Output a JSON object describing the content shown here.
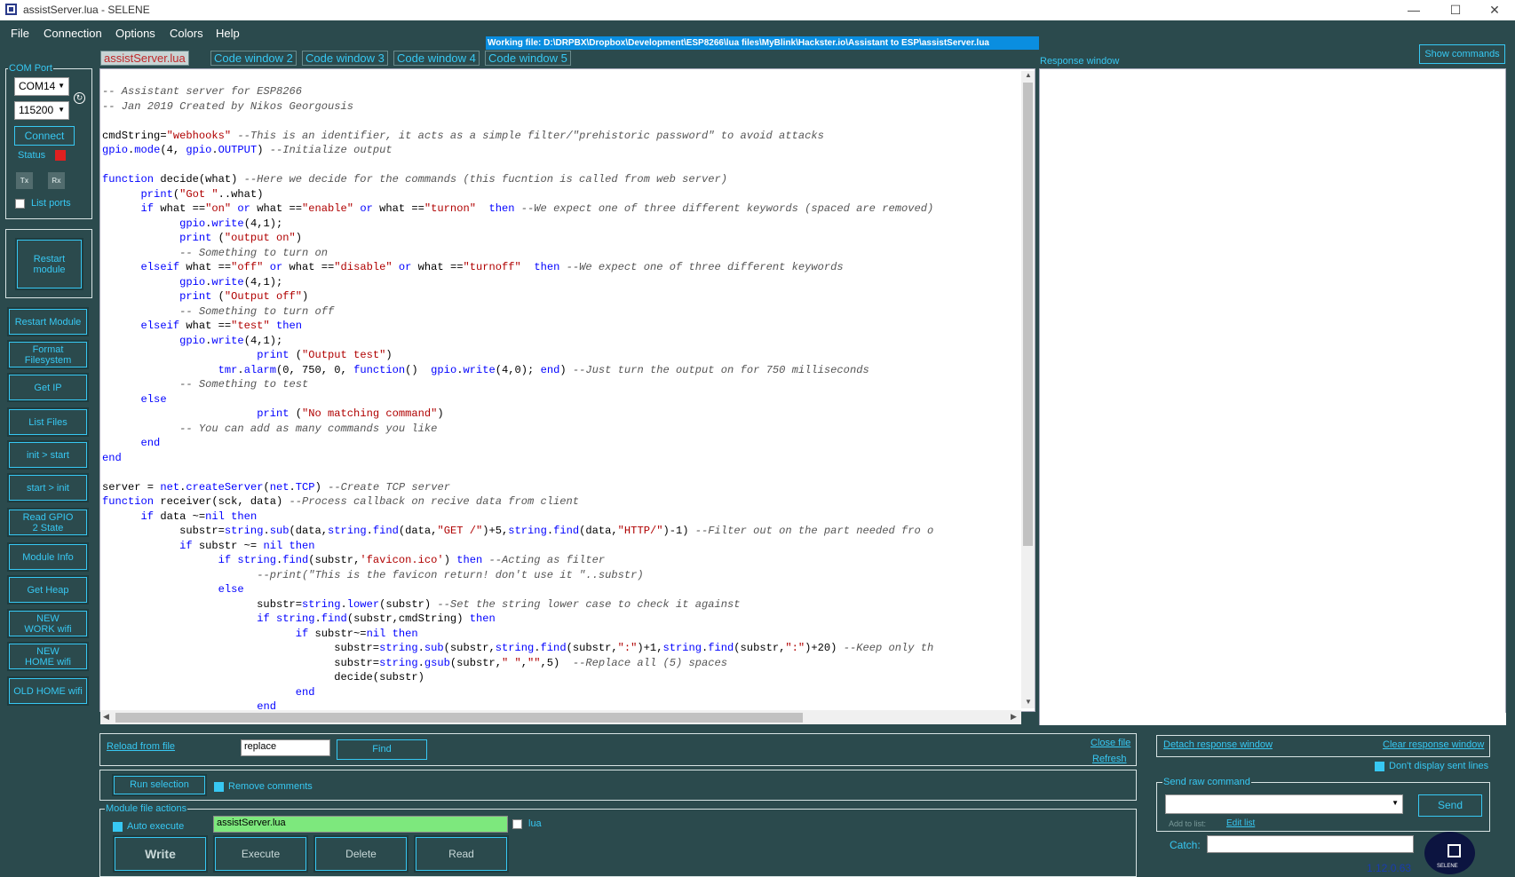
{
  "window": {
    "title": "assistServer.lua - SELENE",
    "minimize": "—",
    "maximize": "☐",
    "close": "✕"
  },
  "menu": [
    "File",
    "Connection",
    "Options",
    "Colors",
    "Help"
  ],
  "working_file": "Working file: D:\\DRPBX\\Dropbox\\Development\\ESP8266\\lua files\\MyBlink\\Hackster.io\\Assistant to ESP\\assistServer.lua",
  "show_commands": "Show commands",
  "response_window_label": "Response window",
  "com_port": {
    "label": "COM Port",
    "port": "COM14",
    "baud": "115200",
    "connect": "Connect",
    "status": "Status",
    "status_color": "#e02020",
    "tx": "Tx",
    "rx": "Rx",
    "list_ports": "List ports"
  },
  "restart_module_big": "Restart module",
  "side_buttons": [
    "Restart Module",
    "Format Filesystem",
    "Get IP",
    "List Files",
    "init > start",
    "start > init",
    "Read GPIO 2 State",
    "Module Info",
    "Get Heap",
    "NEW WORK wifi",
    "NEW HOME wifi",
    "OLD HOME wifi"
  ],
  "tabs": [
    "assistServer.lua",
    "Code window 2",
    "Code window 3",
    "Code window 4",
    "Code window 5"
  ],
  "code_lines": [
    "-- Assistant server for ESP8266",
    "-- Jan 2019 Created by Nikos Georgousis",
    "",
    "cmdString=\"webhooks\" --This is an identifier, it acts as a simple filter/\"prehistoric password\" to avoid attacks",
    "gpio.mode(4, gpio.OUTPUT) --Initialize output",
    "",
    "function decide(what) --Here we decide for the commands (this fucntion is called from web server)",
    "      print(\"Got \"..what)",
    "      if what ==\"on\" or what ==\"enable\" or what ==\"turnon\"  then --We expect one of three different keywords (spaced are removed)",
    "            gpio.write(4,1);",
    "            print (\"output on\")",
    "            -- Something to turn on",
    "      elseif what ==\"off\" or what ==\"disable\" or what ==\"turnoff\"  then --We expect one of three different keywords",
    "            gpio.write(4,1);",
    "            print (\"Output off\")",
    "            -- Something to turn off",
    "      elseif what ==\"test\" then",
    "            gpio.write(4,1);",
    "                        print (\"Output test\")",
    "                  tmr.alarm(0, 750, 0, function()  gpio.write(4,0); end) --Just turn the output on for 750 milliseconds",
    "            -- Something to test",
    "      else",
    "                        print (\"No matching command\")",
    "            -- You can add as many commands you like",
    "      end",
    "end",
    "",
    "server = net.createServer(net.TCP) --Create TCP server",
    "function receiver(sck, data) --Process callback on recive data from client",
    "      if data ~=nil then",
    "            substr=string.sub(data,string.find(data,\"GET /\")+5,string.find(data,\"HTTP/\")-1) --Filter out on the part needed fro o",
    "            if substr ~= nil then",
    "                  if string.find(substr,'favicon.ico') then --Acting as filter",
    "                        --print(\"This is the favicon return! don't use it \"..substr)",
    "                  else",
    "                        substr=string.lower(substr) --Set the string lower case to check it against",
    "                        if string.find(substr,cmdString) then",
    "                              if substr~=nil then",
    "                                    substr=string.sub(substr,string.find(substr,\":\")+1,string.find(substr,\":\")+20) --Keep only th",
    "                                    substr=string.gsub(substr,\" \",\"\",5)  --Replace all (5) spaces",
    "                                    decide(substr)",
    "                              end",
    "                        end"
  ],
  "bottom": {
    "reload_from_file": "Reload from file",
    "search_value": "replace",
    "find": "Find",
    "close_file": "Close file",
    "refresh": "Refresh",
    "run_selection": "Run selection",
    "remove_comments": "Remove comments",
    "module_file_actions": "Module file actions",
    "auto_execute": "Auto execute",
    "filename": "assistServer.lua",
    "lua": "lua",
    "write": "Write",
    "execute": "Execute",
    "delete": "Delete",
    "read": "Read"
  },
  "right_bottom": {
    "detach": "Detach response window",
    "clear": "Clear response window",
    "dont_display": "Don't display sent lines",
    "send_raw_command": "Send raw command",
    "send": "Send",
    "add_to_list": "Add to list:",
    "edit_list": "Edit list",
    "catch": "Catch:",
    "version": "1.12.0.63",
    "logo_text": "SELENE"
  }
}
